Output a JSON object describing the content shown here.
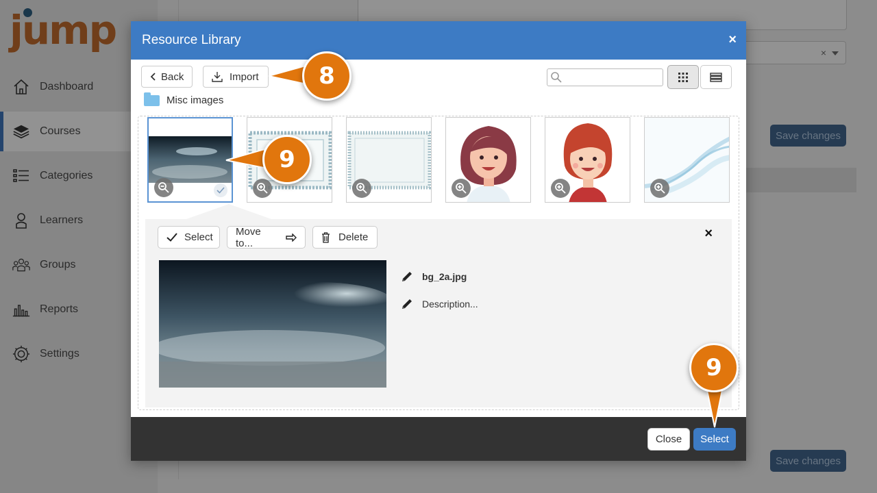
{
  "sidebar": {
    "logo": "jump",
    "items": [
      {
        "label": "Dashboard",
        "icon": "home-icon"
      },
      {
        "label": "Courses",
        "icon": "layers-icon"
      },
      {
        "label": "Categories",
        "icon": "list-icon"
      },
      {
        "label": "Learners",
        "icon": "user-icon"
      },
      {
        "label": "Groups",
        "icon": "group-icon"
      },
      {
        "label": "Reports",
        "icon": "bar-chart-icon"
      },
      {
        "label": "Settings",
        "icon": "gear-icon"
      }
    ]
  },
  "background": {
    "save_label_1": "Save changes",
    "save_label_2": "Save changes",
    "select_clear": "×"
  },
  "modal": {
    "title": "Resource Library",
    "close": "×",
    "back_label": "Back",
    "import_label": "Import",
    "search_placeholder": "",
    "folder_name": "Misc images",
    "thumbnails": [
      {
        "name": "dark-landscape-thumb",
        "selected": true
      },
      {
        "name": "certificate-border-thumb-1",
        "selected": false
      },
      {
        "name": "certificate-border-thumb-2",
        "selected": false
      },
      {
        "name": "woman-brown-hair-thumb",
        "selected": false
      },
      {
        "name": "woman-red-hair-thumb",
        "selected": false
      },
      {
        "name": "blue-wave-thumb",
        "selected": false
      }
    ],
    "detail": {
      "select_label": "Select",
      "move_label": "Move to...",
      "delete_label": "Delete",
      "close": "×",
      "filename": "bg_2a.jpg",
      "description": "Description..."
    },
    "footer": {
      "close_label": "Close",
      "select_label": "Select"
    }
  },
  "callouts": {
    "import_step": "8",
    "thumb_step": "9",
    "select_step": "9"
  },
  "colors": {
    "header": "#3d7bc4",
    "callout": "#e1760d",
    "primary_button": "#3d7bc4"
  }
}
